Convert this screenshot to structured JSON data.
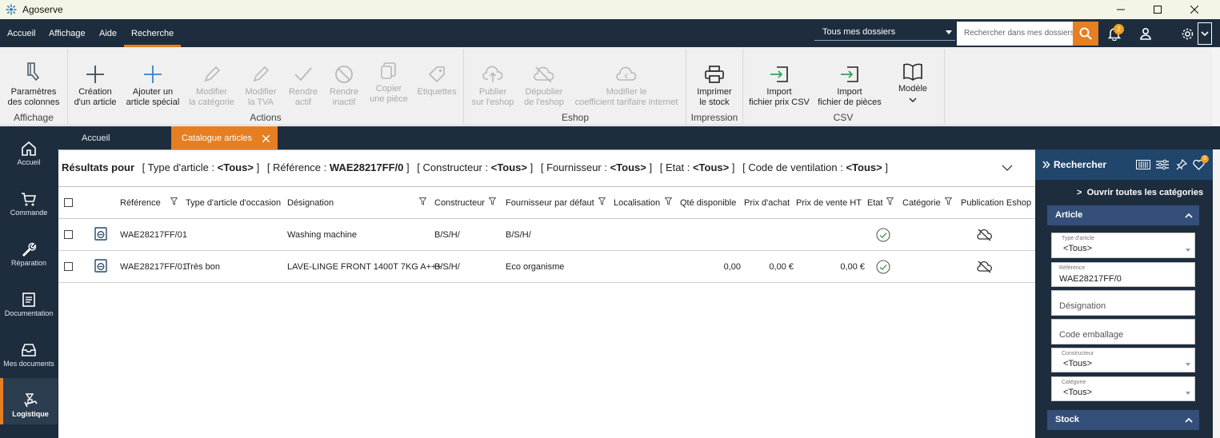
{
  "app": {
    "title": "Agoserve"
  },
  "menu": {
    "items": [
      "Accueil",
      "Affichage",
      "Aide",
      "Recherche"
    ],
    "active": "Recherche"
  },
  "header": {
    "dossier_select": "Tous mes dossiers",
    "search_placeholder": "Rechercher dans mes dossiers",
    "notification_count": "2",
    "icons": [
      "search-icon",
      "bell-icon",
      "user-icon",
      "gear-icon",
      "chevron-down-icon"
    ]
  },
  "ribbon": {
    "buttons": {
      "params": "Paramètres\ndes colonnes",
      "create": "Création\nd'un article",
      "add_special": "Ajouter un\narticle spécial",
      "modify_category": "Modifier\nla catégorie",
      "modify_tva": "Modifier\nla TVA",
      "make_active": "Rendre\nactif",
      "make_inactive": "Rendre\ninactif",
      "copy_piece": "Copier\nune pièce",
      "labels": "Etiquettes",
      "publish": "Publier\nsur l'eshop",
      "unpublish": "Dépublier\nde l'eshop",
      "modify_coef": "Modifier le\ncoefficient tarifaire internet",
      "print_stock": "Imprimer\nle stock",
      "import_price_csv": "Import\nfichier prix CSV",
      "import_pieces": "Import\nfichier de pièces",
      "model": "Modèle"
    },
    "groups": {
      "affichage": "Affichage",
      "actions": "Actions",
      "eshop": "Eshop",
      "impression": "Impression",
      "csv": "CSV"
    }
  },
  "nav": {
    "items": [
      {
        "label": "Accueil",
        "icon": "home-icon"
      },
      {
        "label": "Commande",
        "icon": "cart-icon"
      },
      {
        "label": "Réparation",
        "icon": "wrench-icon"
      },
      {
        "label": "Documentation",
        "icon": "document-icon"
      },
      {
        "label": "Mes documents",
        "icon": "inbox-icon"
      },
      {
        "label": "Logistique",
        "icon": "logistics-icon"
      }
    ],
    "active": "Logistique"
  },
  "tabs": [
    {
      "label": "Accueil"
    },
    {
      "label": "Catalogue articles",
      "active": true
    }
  ],
  "filters": {
    "prefix": "Résultats pour",
    "items": [
      {
        "label": "Type d'article : ",
        "value": "<Tous>"
      },
      {
        "label": "Référence : ",
        "value": "WAE28217FF/0"
      },
      {
        "label": "Constructeur : ",
        "value": "<Tous>"
      },
      {
        "label": "Fournisseur : ",
        "value": "<Tous>"
      },
      {
        "label": "Etat : ",
        "value": "<Tous>"
      },
      {
        "label": "Code de ventilation : ",
        "value": "<Tous>"
      }
    ]
  },
  "table": {
    "columns": [
      "Référence",
      "Type d'article d'occasion",
      "Désignation",
      "Constructeur",
      "Fournisseur par défaut",
      "Localisation",
      "Qté disponible",
      "Prix d'achat",
      "Prix de vente HT",
      "Etat",
      "Catégorie",
      "Publication Eshop"
    ],
    "rows": [
      {
        "reference": "WAE28217FF/01",
        "type": "",
        "designation": "Washing machine",
        "constructeur": "B/S/H/",
        "fournisseur": "B/S/H/",
        "localisation": "",
        "qte": "",
        "prix_achat": "",
        "prix_vente": "",
        "etat": "check-icon",
        "categorie": "",
        "eshop": "cloud-off-icon"
      },
      {
        "reference": "WAE28217FF/01",
        "type": "Très bon",
        "designation": "LAVE-LINGE FRONT 1400T 7KG A+++",
        "constructeur": "B/S/H/",
        "fournisseur": "Eco organisme",
        "localisation": "",
        "qte": "0,00",
        "prix_achat": "0,00 €",
        "prix_vente": "0,00 €",
        "etat": "check-icon",
        "categorie": "",
        "eshop": "cloud-off-icon"
      }
    ]
  },
  "search_panel": {
    "title": "Rechercher",
    "open_all": "Ouvrir toutes les catégories",
    "section_article": "Article",
    "fields": {
      "type_label": "Type d'article",
      "type_value": "<Tous>",
      "ref_label": "Référence",
      "ref_value": "WAE28217FF/0",
      "designation_placeholder": "Désignation",
      "code_placeholder": "Code emballage",
      "constructeur_label": "Constructeur",
      "constructeur_value": "<Tous>",
      "categorie_label": "Catégorie",
      "categorie_value": "<Tous>"
    },
    "section_stock": "Stock",
    "heart_badge": "0"
  },
  "colors": {
    "navy": "#1e2d3e",
    "accent": "#e67e22",
    "panel_header": "#20466c",
    "section": "#34507a"
  }
}
